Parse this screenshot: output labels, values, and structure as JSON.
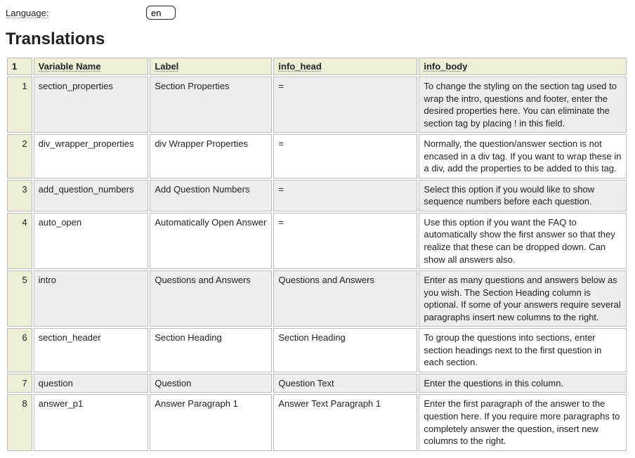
{
  "language": {
    "label": "Language:",
    "value": "en"
  },
  "title": "Translations",
  "table": {
    "corner": "1",
    "headers": {
      "variable_name": "Variable Name",
      "label": "Label",
      "info_head": "info_head",
      "info_body": "info_body"
    },
    "rows": [
      {
        "n": "1",
        "variable_name": "section_properties",
        "label": "Section Properties",
        "info_head": "=",
        "info_body": "To change the styling on the section tag used to wrap the intro, questions and footer, enter the desired properties here. You can eliminate the section tag by placing ! in this field."
      },
      {
        "n": "2",
        "variable_name": "div_wrapper_properties",
        "label": "div Wrapper Properties",
        "info_head": "=",
        "info_body": "Normally, the question/answer section is not encased in a div tag. If you want to wrap these in a div, add the properties to be added to this tag."
      },
      {
        "n": "3",
        "variable_name": "add_question_numbers",
        "label": "Add Question Numbers",
        "info_head": "=",
        "info_body": "Select this option if you would like to show sequence numbers before each question."
      },
      {
        "n": "4",
        "variable_name": "auto_open",
        "label": "Automatically Open Answer",
        "info_head": "=",
        "info_body": "Use this option if you want the FAQ to automatically show the first answer so that they realize that these can be dropped down. Can show all answers also."
      },
      {
        "n": "5",
        "variable_name": "intro",
        "label": "Questions and Answers",
        "info_head": "Questions and Answers",
        "info_body": "Enter as many questions and answers below as you wish. The Section Heading column is optional. If some of your answers require several paragraphs insert new columns to the right."
      },
      {
        "n": "6",
        "variable_name": "section_header",
        "label": "Section Heading",
        "info_head": "Section Heading",
        "info_body": "To group the questions into sections, enter section headings next to the first question in each section."
      },
      {
        "n": "7",
        "variable_name": "question",
        "label": "Question",
        "info_head": "Question Text",
        "info_body": "Enter the questions in this column."
      },
      {
        "n": "8",
        "variable_name": "answer_p1",
        "label": "Answer Paragraph 1",
        "info_head": "Answer Text Paragraph 1",
        "info_body": "Enter the first paragraph of the answer to the question here. If you require more paragraphs to completely answer the question, insert new columns to the right."
      }
    ]
  }
}
